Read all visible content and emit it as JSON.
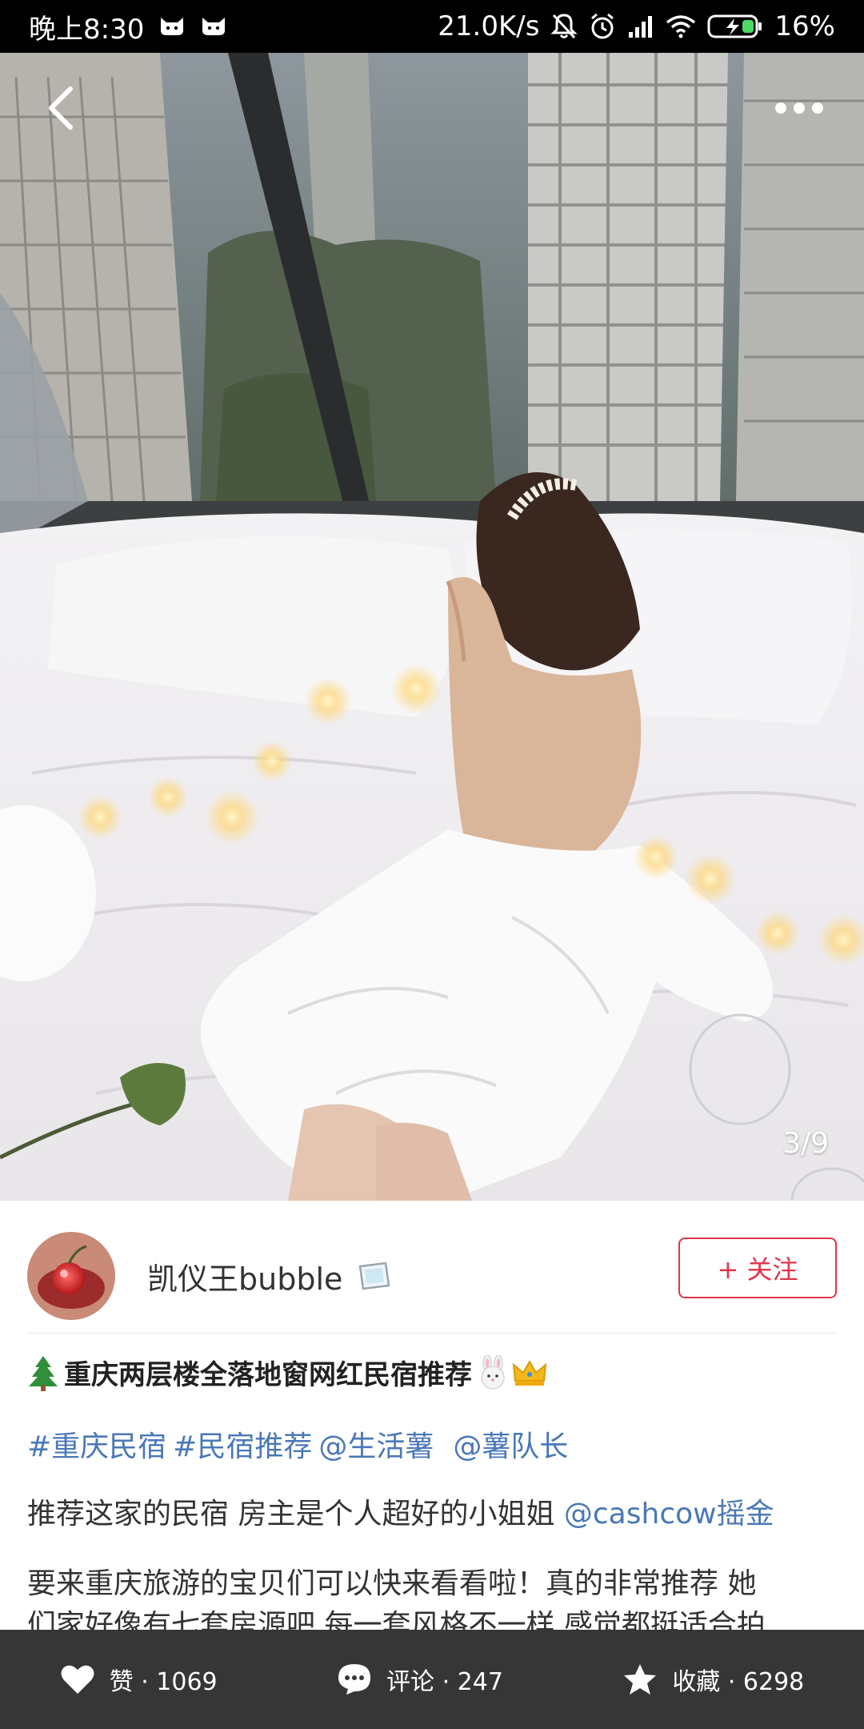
{
  "status_bar": {
    "time": "晚上8:30",
    "network_speed": "21.0K/s",
    "battery": "16%",
    "icons": [
      "cat-icon",
      "cat-icon",
      "mute-icon",
      "alarm-icon",
      "signal-icon",
      "wifi-icon",
      "battery-icon"
    ]
  },
  "photo": {
    "page_indicator": "3/9"
  },
  "author": {
    "name": "凯仪王bubble",
    "follow_label": "+ 关注"
  },
  "post": {
    "title": "重庆两层楼全落地窗网红民宿推荐",
    "tags": [
      "#重庆民宿",
      "#民宿推荐",
      "@生活薯",
      "@薯队长"
    ],
    "para1_text": "推荐这家的民宿 房主是个人超好的小姐姐 ",
    "para1_mention": "@cashcow摇金",
    "para2_line1": "要来重庆旅游的宝贝们可以快来看看啦！真的非常推荐 她",
    "para2_line2": "们家好像有七套房源吧 每一套风格不一样 感觉都挺适合拍"
  },
  "actions": {
    "like": "赞 · 1069",
    "comment": "评论 · 247",
    "favorite": "收藏 · 6298"
  },
  "colors": {
    "accent_red": "#e0354b",
    "link_blue": "#4a78b7",
    "action_bar_bg": "#363636"
  }
}
